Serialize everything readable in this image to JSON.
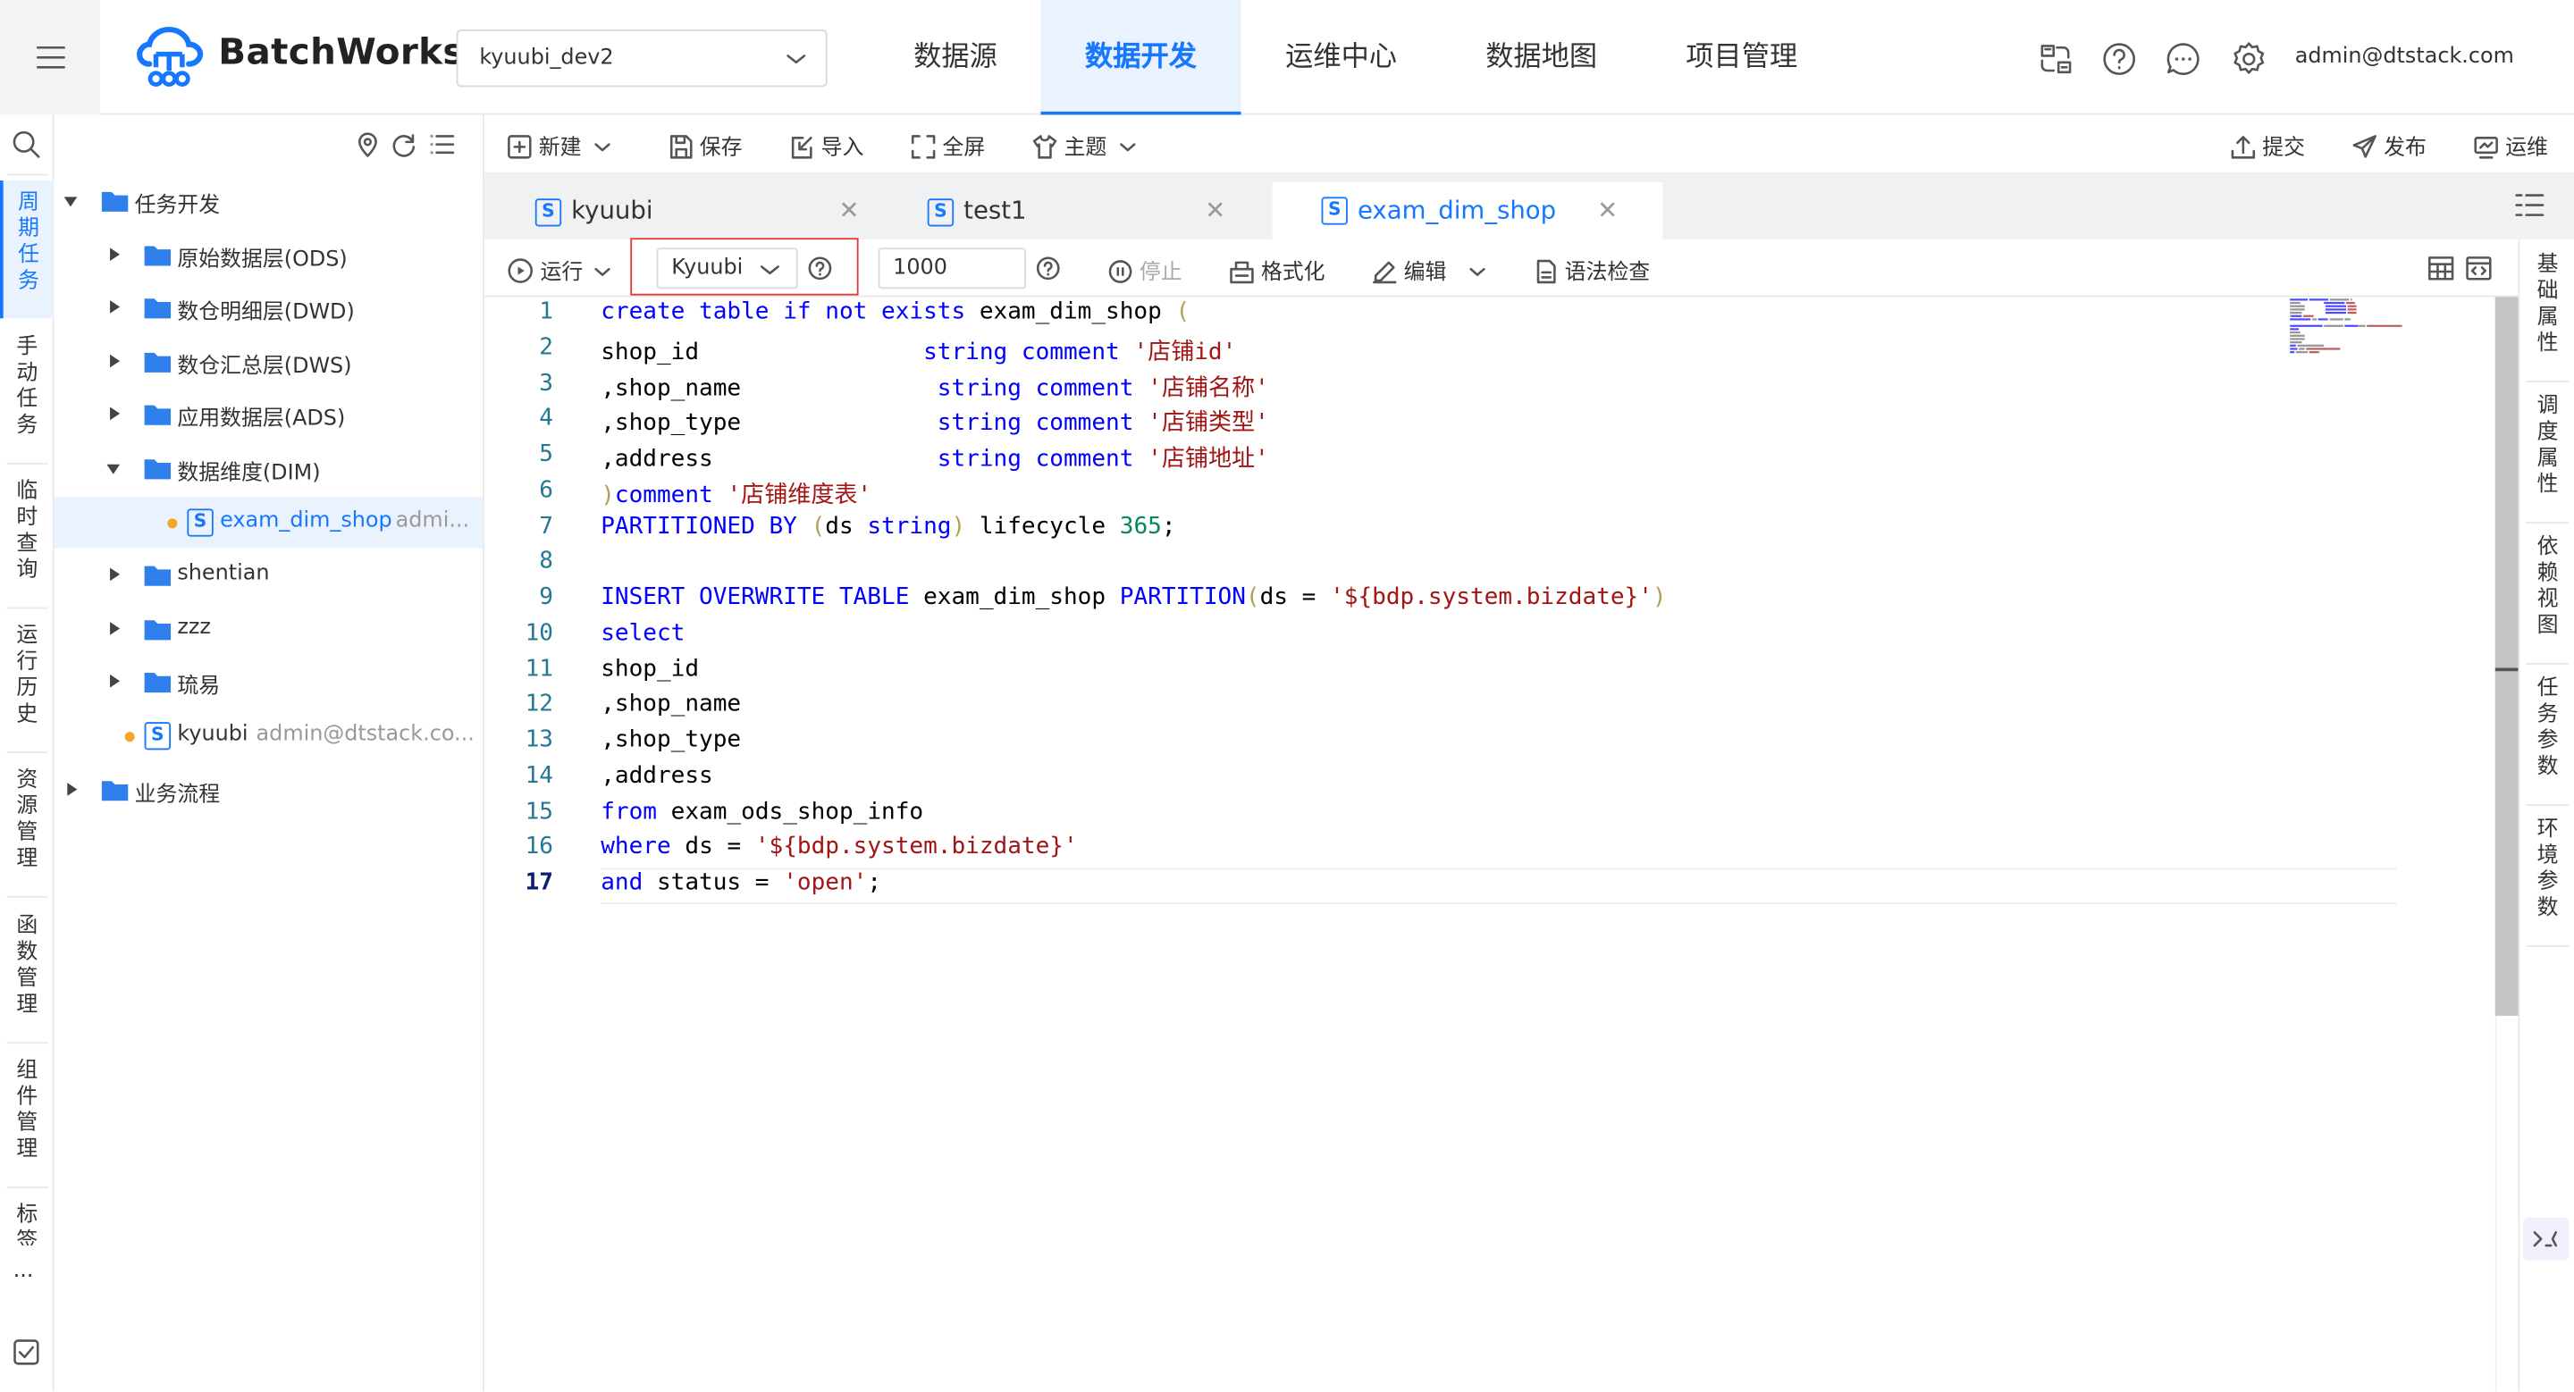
{
  "header": {
    "logo_text": "BatchWorks",
    "project": "kyuubi_dev2",
    "nav": [
      "数据源",
      "数据开发",
      "运维中心",
      "数据地图",
      "项目管理"
    ],
    "nav_active": "数据开发",
    "user": "admin@dtstack.com"
  },
  "left_tabs": [
    "周期任务",
    "手动任务",
    "临时查询",
    "运行历史",
    "资源管理",
    "函数管理",
    "组件管理",
    "标签"
  ],
  "left_tab_active": "周期任务",
  "left_more": "...",
  "tree": {
    "root": "任务开发",
    "folders": [
      "原始数据层(ODS)",
      "数仓明细层(DWD)",
      "数仓汇总层(DWS)",
      "应用数据层(ADS)",
      "数据维度(DIM)"
    ],
    "dim_file": {
      "name": "exam_dim_shop",
      "owner": "admi..."
    },
    "folders2": [
      "shentian",
      "zzz",
      "琉易"
    ],
    "kyuubi_file": {
      "name": "kyuubi",
      "owner": "admin@dtstack.co..."
    },
    "root2": "业务流程"
  },
  "toolbar": {
    "new": "新建",
    "save": "保存",
    "import": "导入",
    "fullscreen": "全屏",
    "theme": "主题",
    "submit": "提交",
    "publish": "发布",
    "ops": "运维"
  },
  "tabs": [
    {
      "label": "kyuubi"
    },
    {
      "label": "test1"
    },
    {
      "label": "exam_dim_shop"
    }
  ],
  "tab_active": "exam_dim_shop",
  "runbar": {
    "run": "运行",
    "engine": "Kyuubi",
    "limit": "1000",
    "stop": "停止",
    "format": "格式化",
    "edit": "编辑",
    "syntax_check": "语法检查"
  },
  "right_tabs": [
    "基础属性",
    "调度属性",
    "依赖视图",
    "任务参数",
    "环境参数"
  ],
  "code_line_numbers": [
    "1",
    "2",
    "3",
    "4",
    "5",
    "6",
    "7",
    "8",
    "9",
    "10",
    "11",
    "12",
    "13",
    "14",
    "15",
    "16",
    "17"
  ],
  "code_text": [
    "create table if not exists exam_dim_shop (",
    "shop_id                string comment '店铺id'",
    ",shop_name              string comment '店铺名称'",
    ",shop_type              string comment '店铺类型'",
    ",address                string comment '店铺地址'",
    ")comment '店铺维度表'",
    "PARTITIONED BY (ds string) lifecycle 365;",
    "",
    "INSERT OVERWRITE TABLE exam_dim_shop PARTITION(ds = '${bdp.system.bizdate}')",
    "select",
    "shop_id",
    ",shop_name",
    ",shop_type",
    ",address",
    "from exam_ods_shop_info",
    "where ds = '${bdp.system.bizdate}'",
    "and status = 'open';"
  ],
  "code": [
    [
      {
        "t": "create table",
        "c": "kw"
      },
      {
        "t": " "
      },
      {
        "t": "if not exists",
        "c": "kw"
      },
      {
        "t": " exam_dim_shop "
      },
      {
        "t": "(",
        "c": "br"
      }
    ],
    [
      {
        "t": "shop_id                "
      },
      {
        "t": "string comment",
        "c": "kw"
      },
      {
        "t": " "
      },
      {
        "t": "'店铺id'",
        "c": "str"
      }
    ],
    [
      {
        "t": ","
      },
      {
        "t": "shop_name              "
      },
      {
        "t": "string comment",
        "c": "kw"
      },
      {
        "t": " "
      },
      {
        "t": "'店铺名称'",
        "c": "str"
      }
    ],
    [
      {
        "t": ","
      },
      {
        "t": "shop_type              "
      },
      {
        "t": "string comment",
        "c": "kw"
      },
      {
        "t": " "
      },
      {
        "t": "'店铺类型'",
        "c": "str"
      }
    ],
    [
      {
        "t": ","
      },
      {
        "t": "address                "
      },
      {
        "t": "string comment",
        "c": "kw"
      },
      {
        "t": " "
      },
      {
        "t": "'店铺地址'",
        "c": "str"
      }
    ],
    [
      {
        "t": ")",
        "c": "br"
      },
      {
        "t": "comment",
        "c": "kw"
      },
      {
        "t": " "
      },
      {
        "t": "'店铺维度表'",
        "c": "str"
      }
    ],
    [
      {
        "t": "PARTITIONED BY",
        "c": "kw"
      },
      {
        "t": " "
      },
      {
        "t": "(",
        "c": "br"
      },
      {
        "t": "ds "
      },
      {
        "t": "string",
        "c": "kw"
      },
      {
        "t": ")",
        "c": "br"
      },
      {
        "t": " lifecycle "
      },
      {
        "t": "365",
        "c": "num"
      },
      {
        "t": ";"
      }
    ],
    [],
    [
      {
        "t": "INSERT OVERWRITE TABLE",
        "c": "kw"
      },
      {
        "t": " exam_dim_shop "
      },
      {
        "t": "PARTITION",
        "c": "kw"
      },
      {
        "t": "(",
        "c": "br"
      },
      {
        "t": "ds = "
      },
      {
        "t": "'${bdp.system.bizdate}'",
        "c": "str"
      },
      {
        "t": ")",
        "c": "br"
      }
    ],
    [
      {
        "t": "select",
        "c": "kw"
      }
    ],
    [
      {
        "t": "shop_id"
      }
    ],
    [
      {
        "t": ","
      },
      {
        "t": "shop_name"
      }
    ],
    [
      {
        "t": ","
      },
      {
        "t": "shop_type"
      }
    ],
    [
      {
        "t": ","
      },
      {
        "t": "address"
      }
    ],
    [
      {
        "t": "from",
        "c": "kw"
      },
      {
        "t": " exam_ods_shop_info"
      }
    ],
    [
      {
        "t": "where",
        "c": "kw"
      },
      {
        "t": " ds = "
      },
      {
        "t": "'${bdp.system.bizdate}'",
        "c": "str"
      }
    ],
    [
      {
        "t": "and",
        "c": "kw"
      },
      {
        "t": " status = "
      },
      {
        "t": "'open'",
        "c": "str"
      },
      {
        "t": ";"
      }
    ]
  ],
  "current_line": 17,
  "colors": {
    "accent": "#1677ff",
    "keyword": "#0000ff",
    "string": "#a31515",
    "number": "#098658",
    "highlight_box": "#e53935",
    "modified_dot": "#f5a623"
  },
  "icons": [
    "menu-icon",
    "cloud-logo-icon",
    "chevron-down-icon",
    "translate-icon",
    "help-icon",
    "chat-icon",
    "settings-icon",
    "search-icon",
    "location-icon",
    "refresh-icon",
    "list-icon",
    "folder-icon",
    "sql-file-icon",
    "plus-square-icon",
    "save-icon",
    "import-icon",
    "fullscreen-icon",
    "theme-icon",
    "upload-icon",
    "send-icon",
    "ops-icon",
    "play-icon",
    "stop-icon",
    "format-icon",
    "edit-icon",
    "syntax-icon",
    "table-icon",
    "code-icon"
  ]
}
